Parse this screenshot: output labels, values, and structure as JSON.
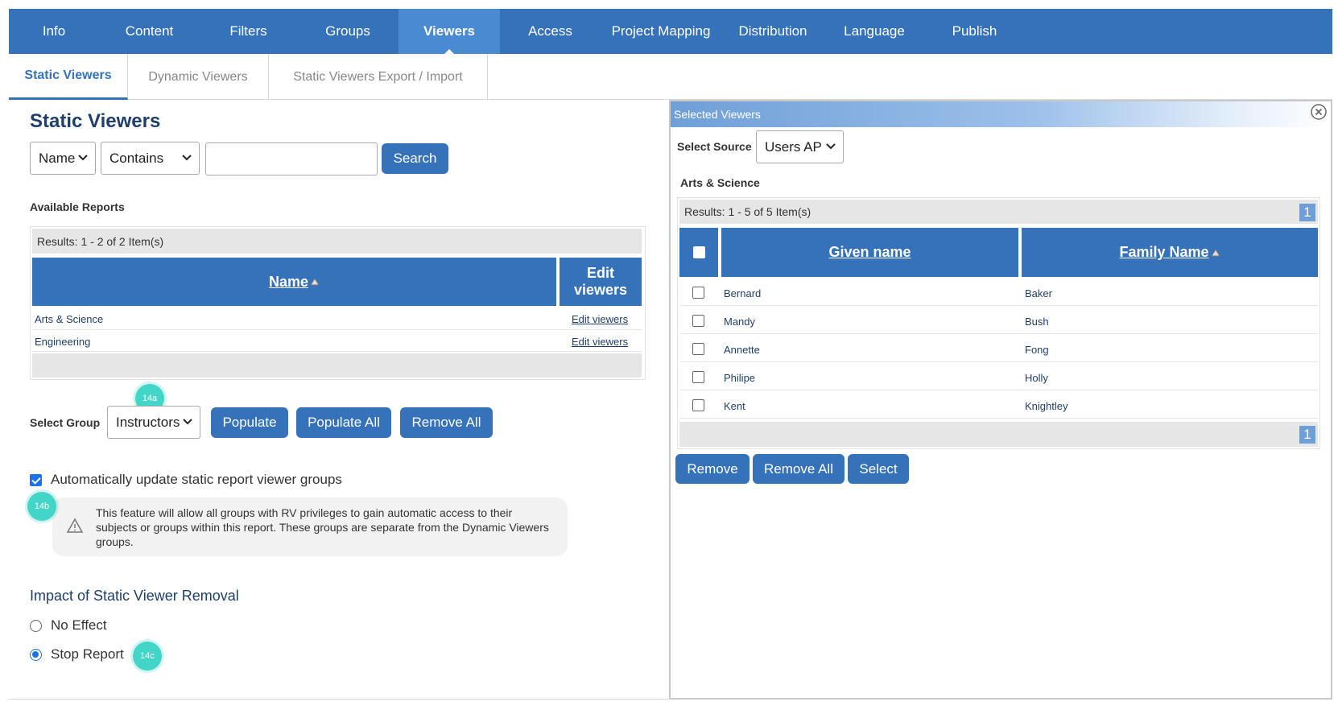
{
  "top_nav": {
    "tabs": [
      {
        "label": "Info"
      },
      {
        "label": "Content"
      },
      {
        "label": "Filters"
      },
      {
        "label": "Groups"
      },
      {
        "label": "Viewers"
      },
      {
        "label": "Access"
      },
      {
        "label": "Project Mapping"
      },
      {
        "label": "Distribution"
      },
      {
        "label": "Language"
      },
      {
        "label": "Publish"
      }
    ],
    "active": "Viewers",
    "color": "#3572b9"
  },
  "sub_tabs": {
    "tabs": [
      {
        "label": "Static Viewers"
      },
      {
        "label": "Dynamic Viewers"
      },
      {
        "label": "Static Viewers Export / Import"
      }
    ],
    "active": "Static Viewers"
  },
  "left": {
    "title": "Static Viewers",
    "search": {
      "field_value": "Name",
      "operator_value": "Contains",
      "query_value": "",
      "button_label": "Search"
    },
    "available_reports_label": "Available Reports",
    "reports_grid": {
      "results_text": "Results: 1 - 2 of 2 Item(s)",
      "columns": [
        "Name",
        "Edit viewers"
      ],
      "rows": [
        {
          "name": "Arts & Science",
          "action": "Edit viewers"
        },
        {
          "name": "Engineering",
          "action": "Edit viewers"
        }
      ]
    },
    "select_group": {
      "label": "Select Group",
      "value": "Instructors",
      "buttons": [
        "Populate",
        "Populate All",
        "Remove All"
      ]
    },
    "badges": {
      "a": "14a",
      "b": "14b",
      "c": "14c"
    },
    "auto_update": {
      "checked": true,
      "label": "Automatically update static report viewer groups"
    },
    "note_text": "This feature will allow all groups with RV privileges to gain automatic access to their subjects or groups within this report. These groups are separate from the Dynamic Viewers groups.",
    "impact": {
      "title": "Impact of Static Viewer Removal",
      "options": [
        {
          "label": "No Effect",
          "checked": false
        },
        {
          "label": "Stop Report",
          "checked": true
        }
      ]
    }
  },
  "right": {
    "header_title": "Selected Viewers",
    "select_source": {
      "label": "Select Source",
      "value": "Users AP"
    },
    "group_title": "Arts & Science",
    "results_text": "Results: 1 - 5 of 5 Item(s)",
    "page_number": "1",
    "columns": [
      "Given name",
      "Family Name"
    ],
    "rows": [
      {
        "given": "Bernard",
        "family": "Baker"
      },
      {
        "given": "Mandy",
        "family": "Bush"
      },
      {
        "given": "Annette",
        "family": "Fong"
      },
      {
        "given": "Philipe",
        "family": "Holly"
      },
      {
        "given": "Kent",
        "family": "Knightley"
      }
    ],
    "buttons": [
      "Remove",
      "Remove All",
      "Select"
    ]
  }
}
